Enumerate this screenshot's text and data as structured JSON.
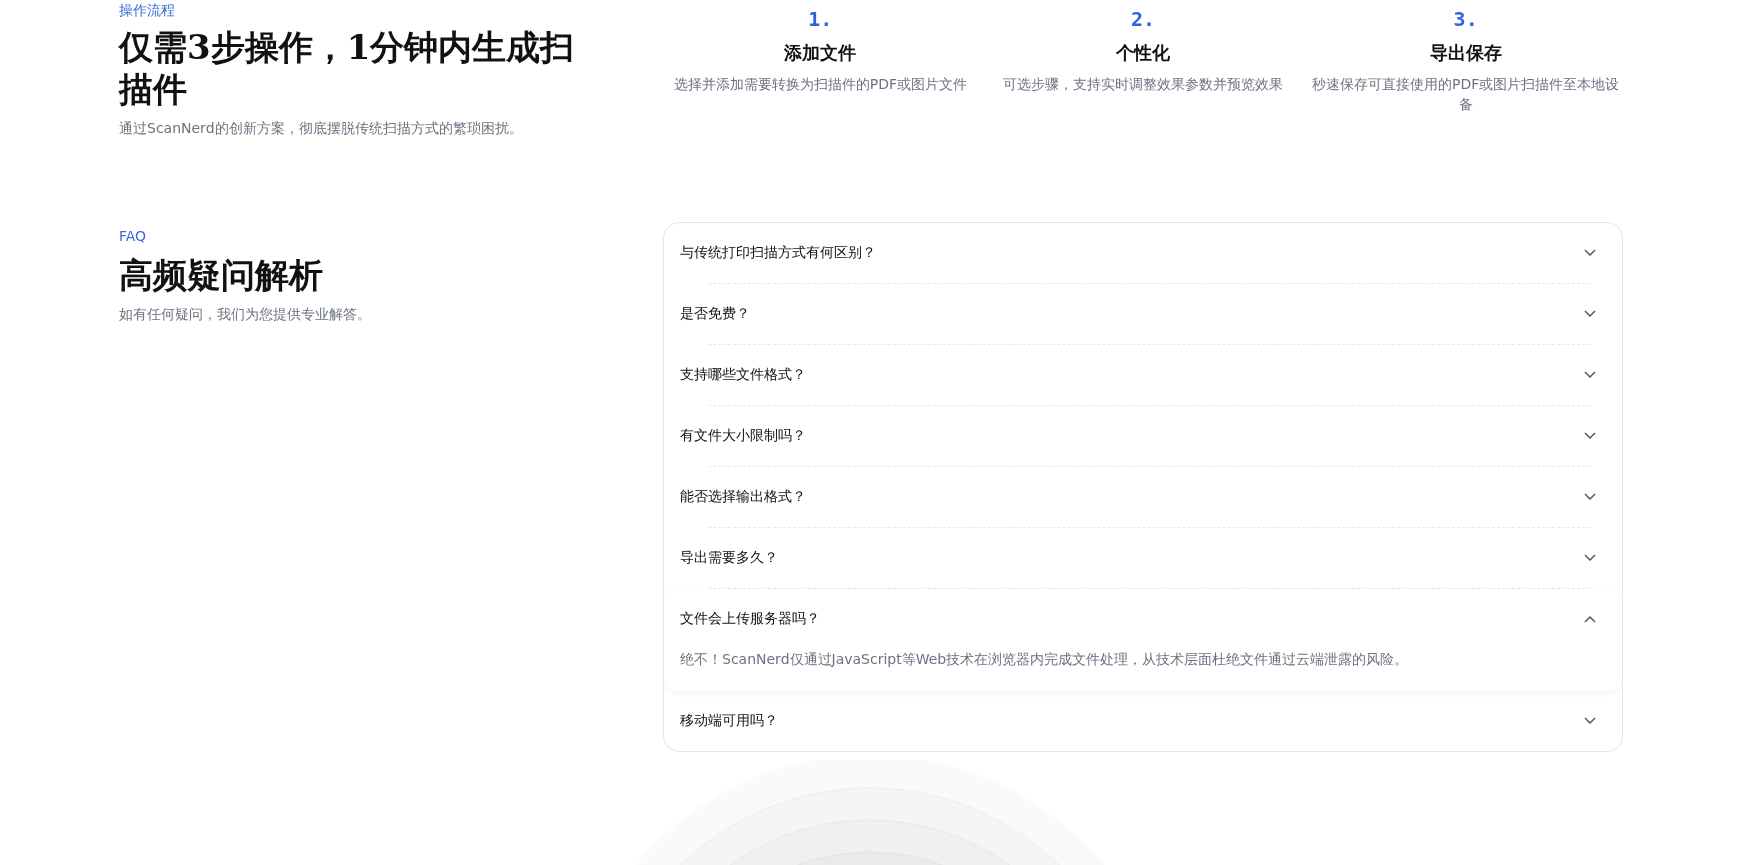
{
  "process": {
    "eyebrow": "操作流程",
    "title": "仅需3步操作，1分钟内生成扫描件",
    "subtitle": "通过ScanNerd的创新方案，彻底摆脱传统扫描方式的繁琐困扰。",
    "steps": [
      {
        "number": "1.",
        "title": "添加文件",
        "text": "选择并添加需要转换为扫描件的PDF或图片文件"
      },
      {
        "number": "2.",
        "title": "个性化",
        "text": "可选步骤，支持实时调整效果参数并预览效果"
      },
      {
        "number": "3.",
        "title": "导出保存",
        "text": "秒速保存可直接使用的PDF或图片扫描件至本地设备"
      }
    ]
  },
  "faq": {
    "eyebrow": "FAQ",
    "title": "高频疑问解析",
    "subtitle": "如有任何疑问，我们为您提供专业解答。",
    "items": [
      {
        "question": "与传统打印扫描方式有何区别？",
        "expanded": false
      },
      {
        "question": "是否免费？",
        "expanded": false
      },
      {
        "question": "支持哪些文件格式？",
        "expanded": false
      },
      {
        "question": "有文件大小限制吗？",
        "expanded": false
      },
      {
        "question": "能否选择输出格式？",
        "expanded": false
      },
      {
        "question": "导出需要多久？",
        "expanded": false
      },
      {
        "question": "文件会上传服务器吗？",
        "expanded": true,
        "answer": "绝不！ScanNerd仅通过JavaScript等Web技术在浏览器内完成文件处理，从技术层面杜绝文件通过云端泄露的风险。"
      },
      {
        "question": "移动端可用吗？",
        "expanded": false
      }
    ]
  }
}
